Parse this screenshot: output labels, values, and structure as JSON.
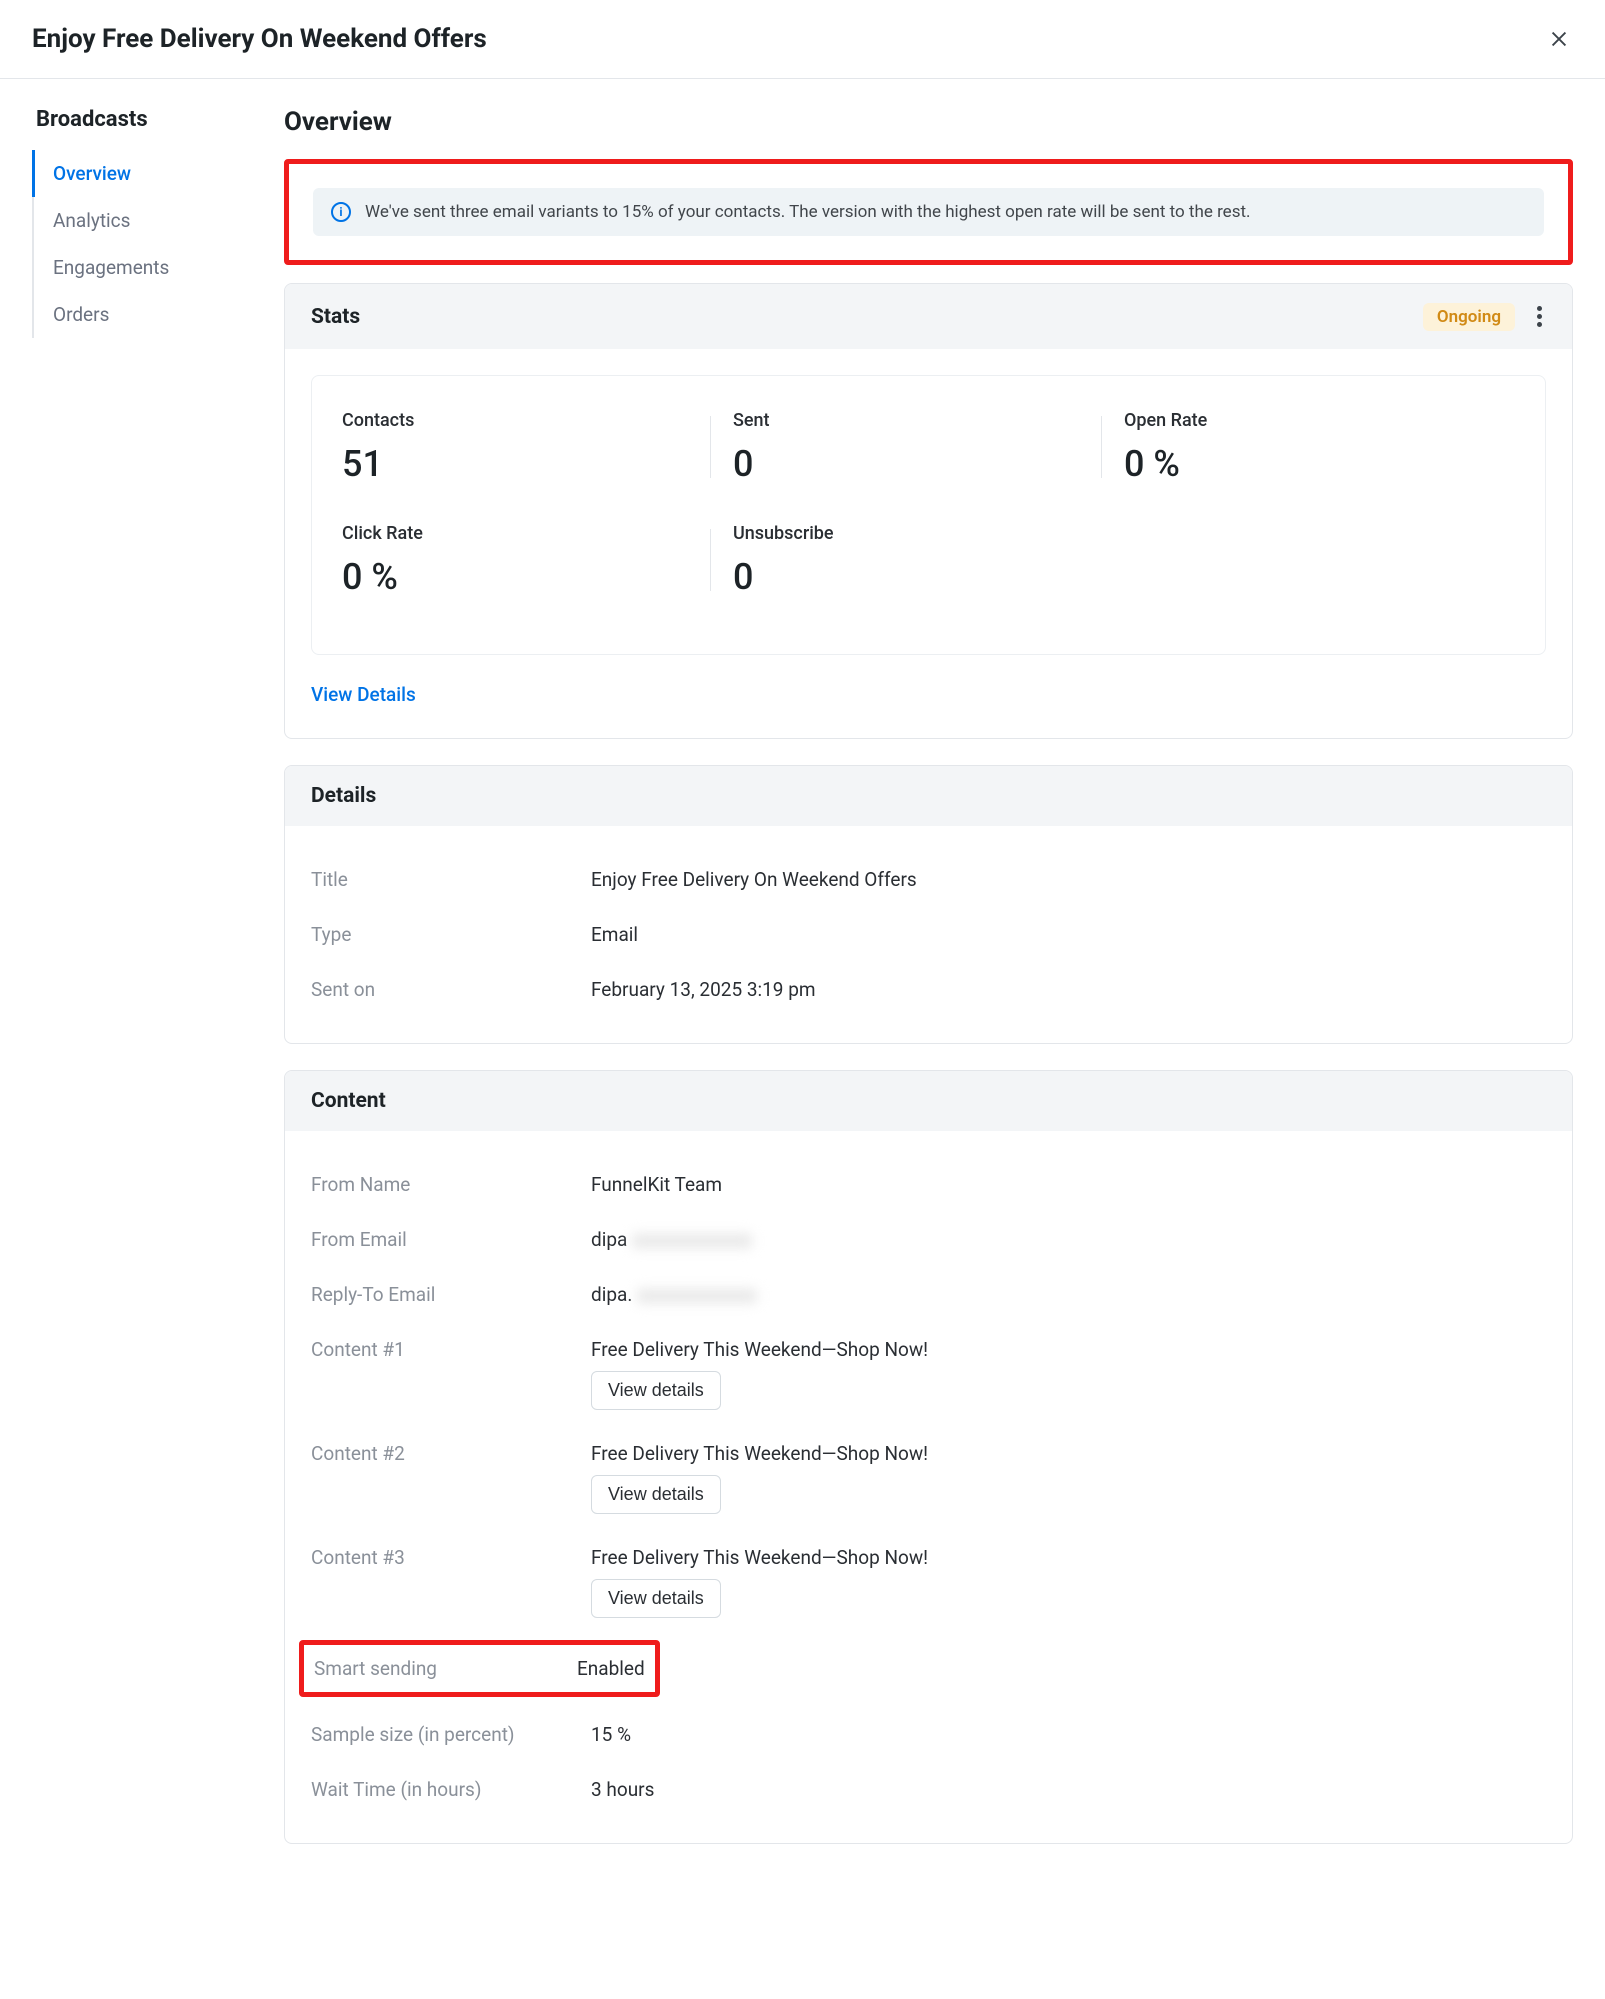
{
  "header": {
    "title": "Enjoy Free Delivery On Weekend Offers"
  },
  "sidebar": {
    "title": "Broadcasts",
    "items": [
      {
        "label": "Overview",
        "active": true
      },
      {
        "label": "Analytics",
        "active": false
      },
      {
        "label": "Engagements",
        "active": false
      },
      {
        "label": "Orders",
        "active": false
      }
    ]
  },
  "main": {
    "title": "Overview",
    "banner": "We've sent three email variants to 15% of your contacts. The version with the highest open rate will be sent to the rest."
  },
  "stats": {
    "heading": "Stats",
    "status": "Ongoing",
    "items": [
      {
        "label": "Contacts",
        "value": "51"
      },
      {
        "label": "Sent",
        "value": "0"
      },
      {
        "label": "Open Rate",
        "value": "0 %"
      },
      {
        "label": "Click Rate",
        "value": "0 %"
      },
      {
        "label": "Unsubscribe",
        "value": "0"
      }
    ],
    "view_details": "View Details"
  },
  "details": {
    "heading": "Details",
    "rows": {
      "title_k": "Title",
      "title_v": "Enjoy Free Delivery On Weekend Offers",
      "type_k": "Type",
      "type_v": "Email",
      "sent_k": "Sent on",
      "sent_v": "February 13, 2025 3:19 pm"
    }
  },
  "content": {
    "heading": "Content",
    "from_name_k": "From Name",
    "from_name_v": "FunnelKit Team",
    "from_email_k": "From Email",
    "from_email_v": "dipa",
    "reply_to_k": "Reply-To Email",
    "reply_to_v": "dipa.",
    "c1_k": "Content #1",
    "c1_v": "Free Delivery This Weekend—Shop Now!",
    "c2_k": "Content #2",
    "c2_v": "Free Delivery This Weekend—Shop Now!",
    "c3_k": "Content #3",
    "c3_v": "Free Delivery This Weekend—Shop Now!",
    "view_details_btn": "View details",
    "smart_k": "Smart sending",
    "smart_v": "Enabled",
    "sample_k": "Sample size (in percent)",
    "sample_v": "15 %",
    "wait_k": "Wait Time (in hours)",
    "wait_v": "3 hours"
  }
}
